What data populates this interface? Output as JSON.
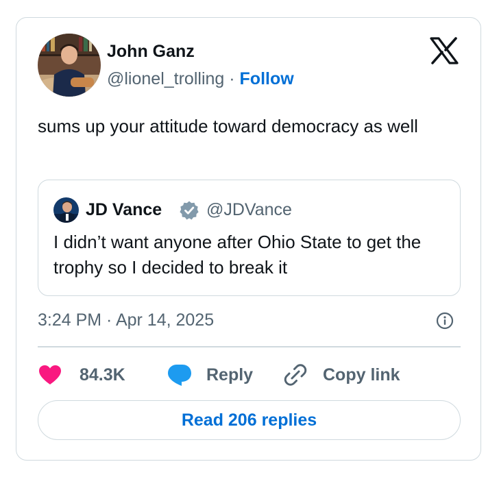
{
  "author": {
    "name": "John Ganz",
    "handle": "@lionel_trolling",
    "separator": " · ",
    "follow_label": "Follow"
  },
  "tweet": {
    "text": "sums up your attitude toward democracy as well"
  },
  "quoted_tweet": {
    "name": "JD Vance",
    "handle": "@JDVance",
    "text": "I didn’t want anyone after Ohio State to get the trophy so I decided to break it"
  },
  "meta": {
    "timestamp": "3:24 PM · Apr 14, 2025"
  },
  "actions": {
    "like_count": "84.3K",
    "reply_label": "Reply",
    "copy_link_label": "Copy link"
  },
  "read_replies_label": "Read 206 replies",
  "icons": {
    "brand": "x-logo-icon",
    "verified": "verified-badge-icon",
    "info": "info-icon",
    "like": "heart-icon",
    "reply": "speech-bubble-icon",
    "copy": "link-icon"
  },
  "colors": {
    "link_blue": "#006fd6",
    "like_pink": "#f91880",
    "reply_blue": "#1d9bf0",
    "muted_gray": "#536471",
    "border": "#cfd9de",
    "verified_gray": "#829aab"
  }
}
